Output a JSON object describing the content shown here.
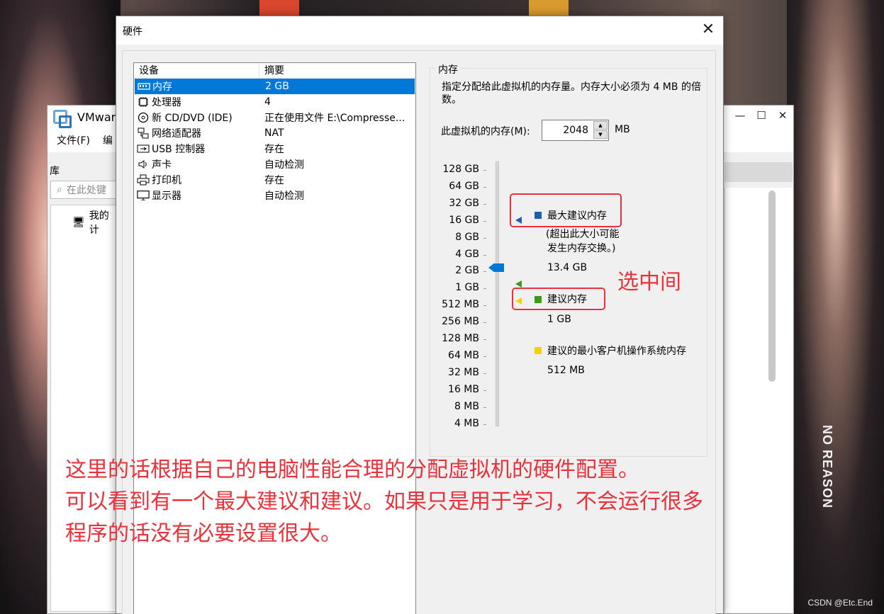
{
  "wallpaper": {
    "side_text": "NO REASON",
    "watermark": "CSDN @Etc.End"
  },
  "vmware": {
    "title": "VMwar",
    "menu": [
      "文件(F)",
      "编"
    ],
    "library_label": "库",
    "search_placeholder": "在此处键",
    "tree_item": "我的计"
  },
  "dialog": {
    "title": "硬件",
    "close": "✕",
    "device_list": {
      "columns": [
        "设备",
        "摘要"
      ],
      "rows": [
        {
          "device": "内存",
          "summary": "2 GB",
          "icon": "memory-icon",
          "selected": true
        },
        {
          "device": "处理器",
          "summary": "4",
          "icon": "cpu-icon",
          "selected": false
        },
        {
          "device": "新 CD/DVD (IDE)",
          "summary": "正在使用文件 E:\\Compresse...",
          "icon": "cd-icon",
          "selected": false
        },
        {
          "device": "网络适配器",
          "summary": "NAT",
          "icon": "network-icon",
          "selected": false
        },
        {
          "device": "USB 控制器",
          "summary": "存在",
          "icon": "usb-icon",
          "selected": false
        },
        {
          "device": "声卡",
          "summary": "自动检测",
          "icon": "speaker-icon",
          "selected": false
        },
        {
          "device": "打印机",
          "summary": "存在",
          "icon": "printer-icon",
          "selected": false
        },
        {
          "device": "显示器",
          "summary": "自动检测",
          "icon": "monitor-icon",
          "selected": false
        }
      ]
    },
    "memory": {
      "group_title": "内存",
      "description": "指定分配给此虚拟机的内存量。内存大小必须为 4 MB 的倍数。",
      "field_label": "此虚拟机的内存(M):",
      "value": "2048",
      "unit": "MB",
      "scale": [
        "128 GB",
        "64 GB",
        "32 GB",
        "16 GB",
        "8 GB",
        "4 GB",
        "2 GB",
        "1 GB",
        "512 MB",
        "256 MB",
        "128 MB",
        "64 MB",
        "32 MB",
        "16 MB",
        "8 MB",
        "4 MB"
      ],
      "max_recommended": {
        "title": "最大建议内存",
        "note1": "(超出此大小可能",
        "note2": "发生内存交换。)",
        "value": "13.4 GB",
        "color": "#1f5fb0"
      },
      "recommended": {
        "title": "建议内存",
        "value": "1 GB",
        "color": "#3a9a1e"
      },
      "min_os": {
        "title": "建议的最小客户机操作系统内存",
        "value": "512 MB",
        "color": "#f2d20a"
      }
    }
  },
  "annotations": {
    "middle": "选中间",
    "line1": "这里的话根据自己的电脑性能合理的分配虚拟机的硬件配置。",
    "line2": "可以看到有一个最大建议和建议。如果只是用于学习，不会运行很多",
    "line3": "程序的话没有必要设置很大。",
    "color": "#e8323c"
  }
}
